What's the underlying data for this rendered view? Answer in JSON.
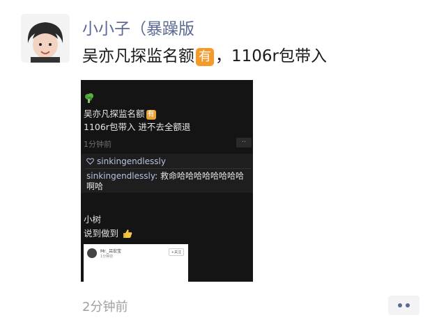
{
  "post": {
    "author": "小小子（暴躁版",
    "text_before": "吴亦凡探监名额",
    "emoji_label": "有",
    "text_after": "，1106r包带入",
    "time": "2分钟前"
  },
  "screenshot": {
    "line1": "吴亦凡探监名额",
    "emoji_label": "有",
    "line2": "1106r包带入 进不去全额退",
    "time": "1分钟前",
    "more_label": "··",
    "like_user": "sinkingendlessly",
    "comment_user": "sinkingendlessly",
    "comment_text": ": 救命哈哈哈哈哈哈哈哈啊哈",
    "reply_name": "小树",
    "reply_text": "说到做到",
    "card": {
      "name": "Mr._吕宏宝",
      "sub": "1分钟前",
      "follow": "+关注"
    }
  },
  "colors": {
    "author": "#5a6a94",
    "emoji_bg": "#f39a2b",
    "screenshot_bg": "#141414"
  }
}
